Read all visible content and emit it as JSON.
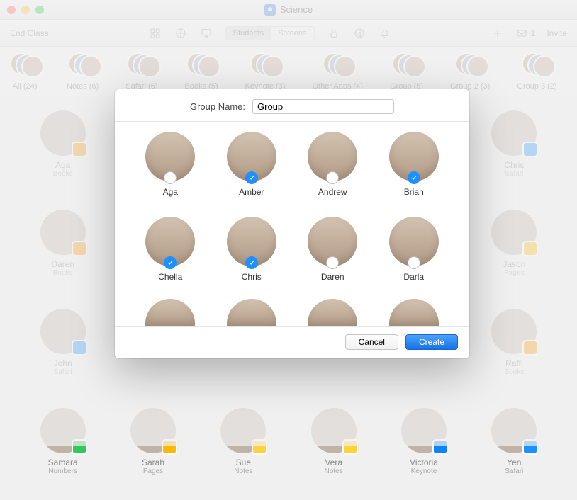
{
  "window": {
    "title": "Science"
  },
  "toolbar": {
    "end_class": "End Class",
    "seg_students": "Students",
    "seg_screens": "Screens",
    "invite": "Invite",
    "mail_count": "1"
  },
  "groups_row": [
    {
      "label": "All (24)"
    },
    {
      "label": "Notes (6)"
    },
    {
      "label": "Safari (6)"
    },
    {
      "label": "Books (5)"
    },
    {
      "label": "Keynote (3)"
    },
    {
      "label": "Other Apps (4)"
    },
    {
      "label": "Group (5)"
    },
    {
      "label": "Group 2 (3)"
    },
    {
      "label": "Group 3 (2)"
    }
  ],
  "bg_students": [
    {
      "name": "Aga",
      "app": "Books",
      "appclass": "books"
    },
    {
      "name": "Chris",
      "app": "Safari",
      "appclass": "safari"
    },
    {
      "name": "Daren",
      "app": "Books",
      "appclass": "books"
    },
    {
      "name": "Jason",
      "app": "Pages",
      "appclass": "pages"
    },
    {
      "name": "John",
      "app": "Safari",
      "appclass": "safari"
    },
    {
      "name": "Raffi",
      "app": "Books",
      "appclass": "books"
    },
    {
      "name": "Samara",
      "app": "Numbers",
      "appclass": "numbers"
    },
    {
      "name": "Sarah",
      "app": "Pages",
      "appclass": "pages"
    },
    {
      "name": "Sue",
      "app": "Notes",
      "appclass": "notes"
    },
    {
      "name": "Vera",
      "app": "Notes",
      "appclass": "notes"
    },
    {
      "name": "Victoria",
      "app": "Keynote",
      "appclass": "keynote"
    },
    {
      "name": "Yen",
      "app": "Safari",
      "appclass": "safari"
    }
  ],
  "modal": {
    "label": "Group Name:",
    "input_value": "Group",
    "cancel": "Cancel",
    "create": "Create",
    "students": [
      {
        "name": "Aga",
        "selected": false
      },
      {
        "name": "Amber",
        "selected": true
      },
      {
        "name": "Andrew",
        "selected": false
      },
      {
        "name": "Brian",
        "selected": true
      },
      {
        "name": "Chella",
        "selected": true
      },
      {
        "name": "Chris",
        "selected": true
      },
      {
        "name": "Daren",
        "selected": false
      },
      {
        "name": "Darla",
        "selected": false
      }
    ]
  }
}
